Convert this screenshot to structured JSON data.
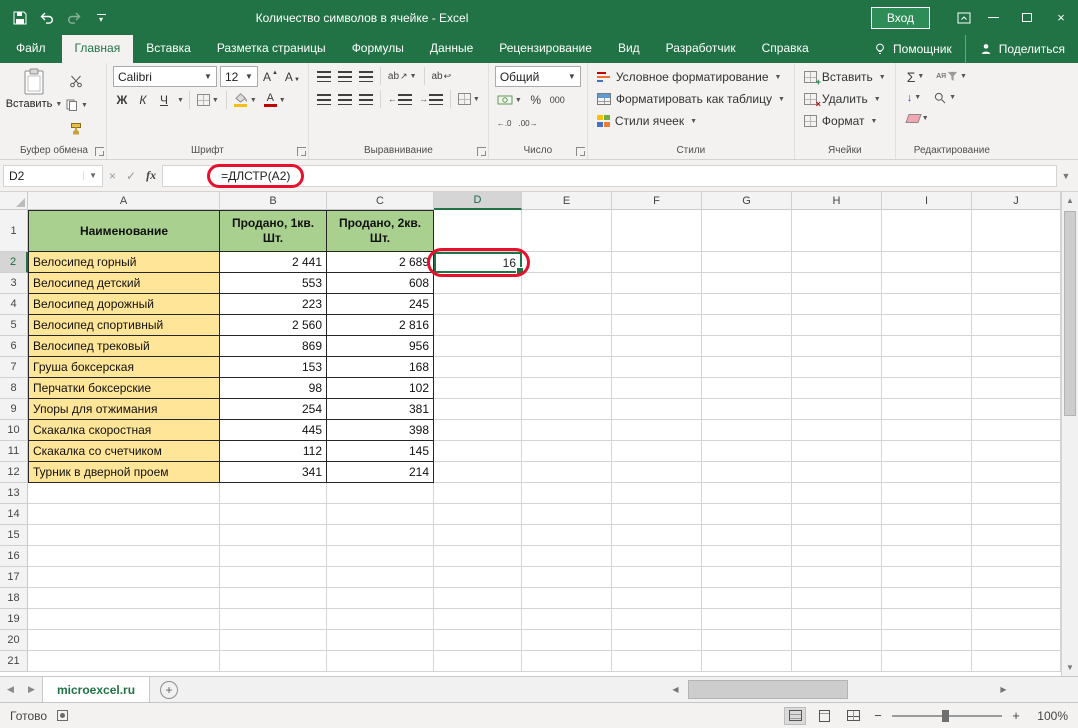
{
  "title_bar": {
    "title": "Количество символов в ячейке  -  Excel",
    "sign_in": "Вход"
  },
  "ribbon_tabs": {
    "file": "Файл",
    "tabs": [
      "Главная",
      "Вставка",
      "Разметка страницы",
      "Формулы",
      "Данные",
      "Рецензирование",
      "Вид",
      "Разработчик",
      "Справка"
    ],
    "active": "Главная",
    "assistant": "Помощник",
    "share": "Поделиться"
  },
  "ribbon": {
    "clipboard": {
      "label": "Буфер обмена",
      "paste": "Вставить"
    },
    "font": {
      "label": "Шрифт",
      "name": "Calibri",
      "size": "12",
      "letter": "А",
      "bold": "Ж",
      "italic": "К",
      "underline": "Ч"
    },
    "alignment": {
      "label": "Выравнивание",
      "ab": "ab"
    },
    "number": {
      "label": "Число",
      "format": "Общий",
      "percent": "%",
      "thousands": "000"
    },
    "styles": {
      "label": "Стили",
      "items": [
        "Условное форматирование",
        "Форматировать как таблицу",
        "Стили ячеек"
      ]
    },
    "cells": {
      "label": "Ячейки",
      "items": [
        "Вставить",
        "Удалить",
        "Формат"
      ]
    },
    "editing": {
      "label": "Редактирование",
      "sum": "Σ",
      "sort_letters": "АЯ"
    }
  },
  "formula_bar": {
    "name_box": "D2",
    "fx": "fx",
    "formula": "=ДЛСТР(A2)"
  },
  "grid": {
    "columns": [
      "A",
      "B",
      "C",
      "D",
      "E",
      "F",
      "G",
      "H",
      "I",
      "J"
    ],
    "header_row": [
      "Наименование",
      "Продано, 1кв.\nШт.",
      "Продано, 2кв.\nШт.",
      "",
      "",
      "",
      "",
      "",
      "",
      ""
    ],
    "rows": [
      [
        "Велосипед горный",
        "2 441",
        "2 689",
        "16"
      ],
      [
        "Велосипед детский",
        "553",
        "608",
        ""
      ],
      [
        "Велосипед дорожный",
        "223",
        "245",
        ""
      ],
      [
        "Велосипед спортивный",
        "2 560",
        "2 816",
        ""
      ],
      [
        "Велосипед трековый",
        "869",
        "956",
        ""
      ],
      [
        "Груша боксерская",
        "153",
        "168",
        ""
      ],
      [
        "Перчатки боксерские",
        "98",
        "102",
        ""
      ],
      [
        "Упоры для отжимания",
        "254",
        "381",
        ""
      ],
      [
        "Скакалка скоростная",
        "445",
        "398",
        ""
      ],
      [
        "Скакалка со счетчиком",
        "112",
        "145",
        ""
      ],
      [
        "Турник в дверной проем",
        "341",
        "214",
        ""
      ]
    ],
    "first_data_row": 2,
    "total_rows": 21,
    "selected_cell": "D2",
    "selected_value": "16"
  },
  "sheet_tabs": {
    "active_tab": "microexcel.ru"
  },
  "status_bar": {
    "mode": "Готово",
    "zoom": "100%"
  },
  "colors": {
    "excel_green": "#217346",
    "table_header_fill": "#a9d08e",
    "name_column_fill": "#ffe598",
    "selection_border": "#217346",
    "annotation_red": "#e8112d"
  }
}
